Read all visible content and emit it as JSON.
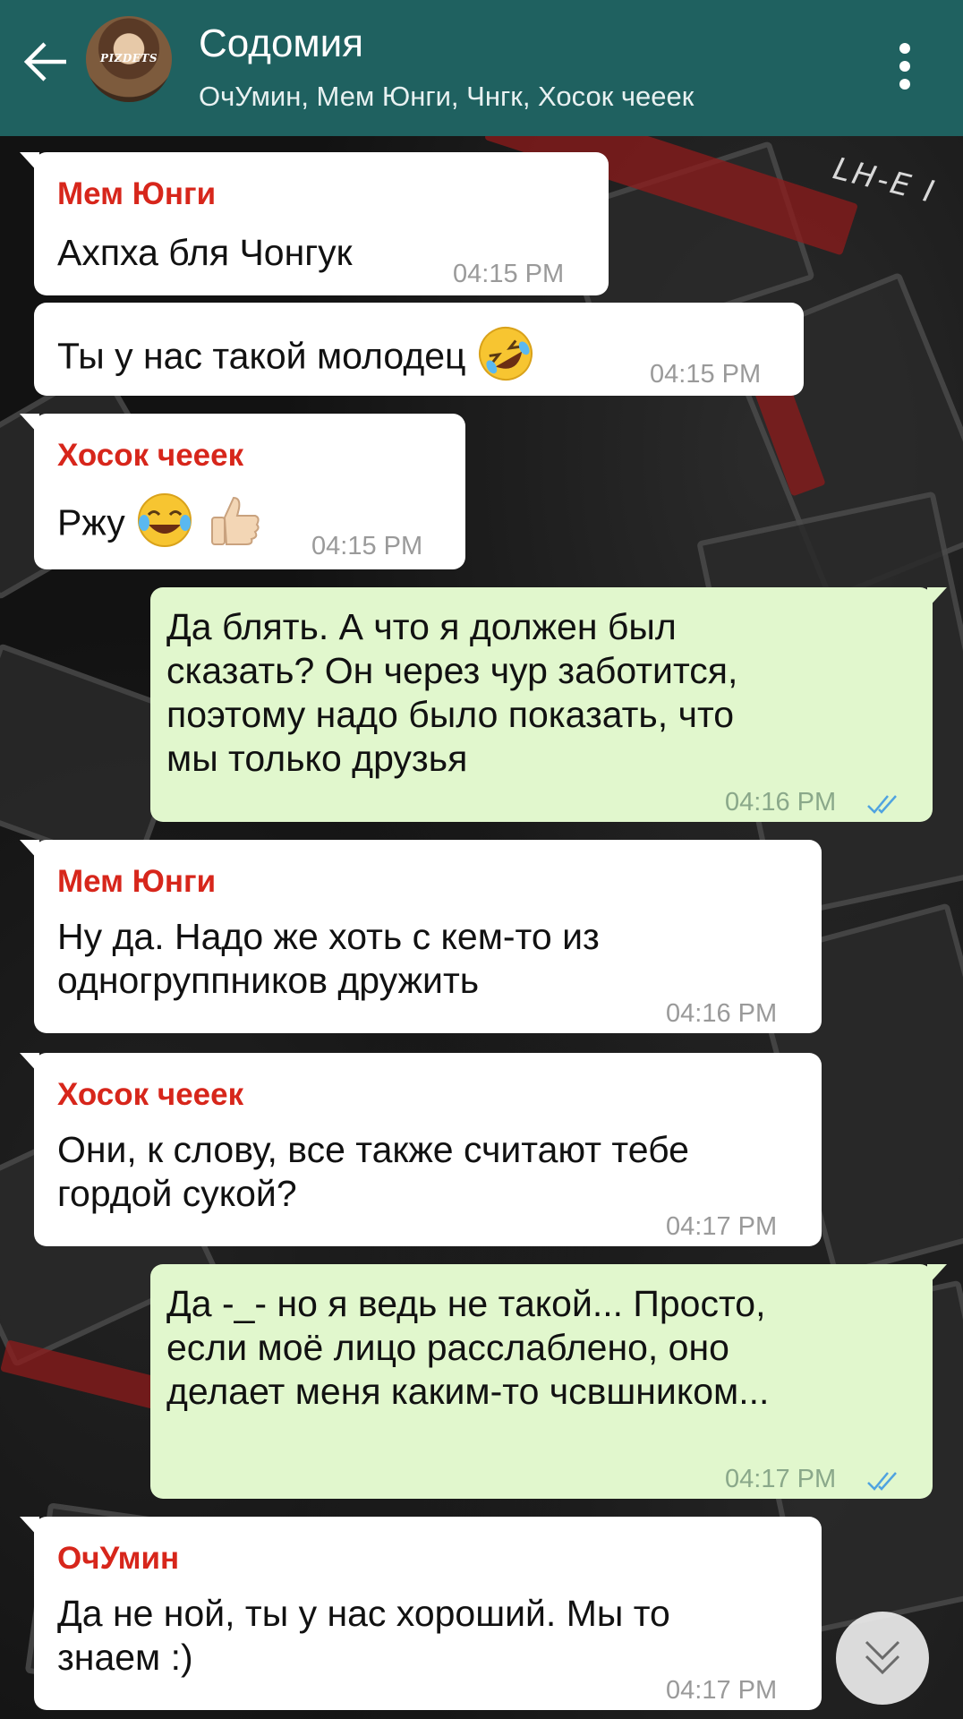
{
  "header": {
    "title": "Содомия",
    "subtitle": "ОчУмин, Мем Юнги, Чнгк, Хосок чееек",
    "avatar_text": "PIZDETS"
  },
  "wallpaper_text": "LH-E I",
  "messages": [
    {
      "direction": "in",
      "sender": "Мем Юнги",
      "lines": [
        "Ахпха бля Чонгук"
      ],
      "time": "04:15 PM"
    },
    {
      "direction": "in",
      "sender": "",
      "lines": [
        "Ты у нас такой молодец"
      ],
      "emoji": "rolling-on-floor-laughing",
      "time": "04:15 PM"
    },
    {
      "direction": "in",
      "sender": "Хосок чееек",
      "lines": [
        "Ржу"
      ],
      "emoji": "tears-of-joy + thumbs-up",
      "time": "04:15 PM"
    },
    {
      "direction": "out",
      "lines": [
        "Да блять. А что я должен был",
        "сказать? Он через чур заботится,",
        "поэтому надо было показать, что",
        "мы только друзья"
      ],
      "time": "04:16 PM",
      "read": true
    },
    {
      "direction": "in",
      "sender": "Мем Юнги",
      "lines": [
        "Ну да. Надо же хоть с кем-то из",
        "одногруппников дружить"
      ],
      "time": "04:16 PM"
    },
    {
      "direction": "in",
      "sender": "Хосок чееек",
      "lines": [
        "Они, к слову, все также считают тебе",
        "гордой сукой?"
      ],
      "time": "04:17 PM"
    },
    {
      "direction": "out",
      "lines": [
        "Да -_- но я ведь не такой... Просто,",
        "если моё лицо расслаблено, оно",
        "делает меня каким-то чсвшником..."
      ],
      "time": "04:17 PM",
      "read": true
    },
    {
      "direction": "in",
      "sender": "ОчУмин",
      "lines": [
        "Да не ной, ты у нас хороший. Мы то",
        "знаем :)"
      ],
      "time": "04:17 PM"
    }
  ],
  "colors": {
    "appbar": "#1f6160",
    "incoming_bubble": "#ffffff",
    "outgoing_bubble": "#e1f7cd",
    "sender_name": "#d7261b",
    "read_ticks": "#4fa3e0"
  }
}
